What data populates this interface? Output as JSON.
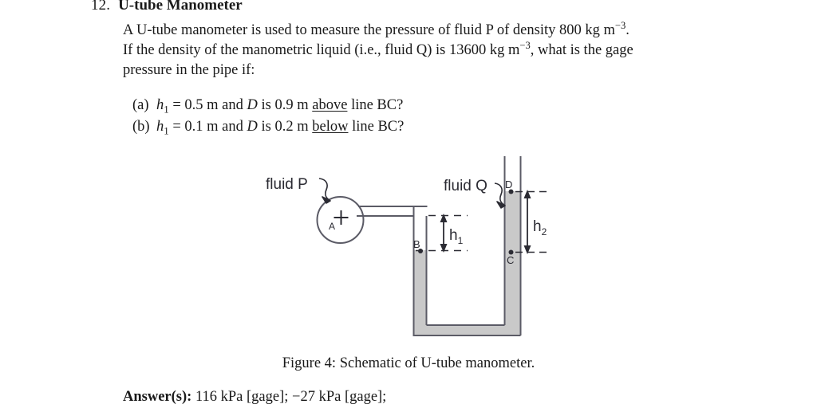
{
  "problem": {
    "number": "12.",
    "title": "U-tube Manometer",
    "body_line1_a": "A U-tube manometer is used to measure the pressure of fluid P of density 800 kg m",
    "body_line1_exp": "−3",
    "body_line1_b": ".",
    "body_line2_a": "If the density of the manometric liquid (i.e., fluid Q) is 13600 kg m",
    "body_line2_exp": "−3",
    "body_line2_b": ", what is the gage",
    "body_line3": "pressure in the pipe if:",
    "items": [
      {
        "label": "(a)",
        "var": "h",
        "sub": "1",
        "eq": "= 0.5 m and",
        "var2": "D",
        "mid": "is 0.9 m",
        "emph": "above",
        "tail": "line BC?"
      },
      {
        "label": "(b)",
        "var": "h",
        "sub": "1",
        "eq": "= 0.1 m and",
        "var2": "D",
        "mid": "is 0.2 m",
        "emph": "below",
        "tail": "line BC?"
      }
    ]
  },
  "figure": {
    "caption": "Figure 4: Schematic of U-tube manometer.",
    "labels": {
      "fluid_p": "fluid P",
      "fluid_q": "fluid Q",
      "point_a": "A",
      "point_b": "B",
      "point_c": "C",
      "point_d": "D",
      "h1": "h",
      "h1_sub": "1",
      "h2": "h",
      "h2_sub": "2"
    },
    "colors": {
      "fluid_fill": "#c9c9c9",
      "outline": "#4a4a55",
      "ink": "#2b2b33"
    }
  },
  "answer": {
    "label": "Answer(s):",
    "value": "116 kPa [gage]; −27 kPa [gage];"
  }
}
